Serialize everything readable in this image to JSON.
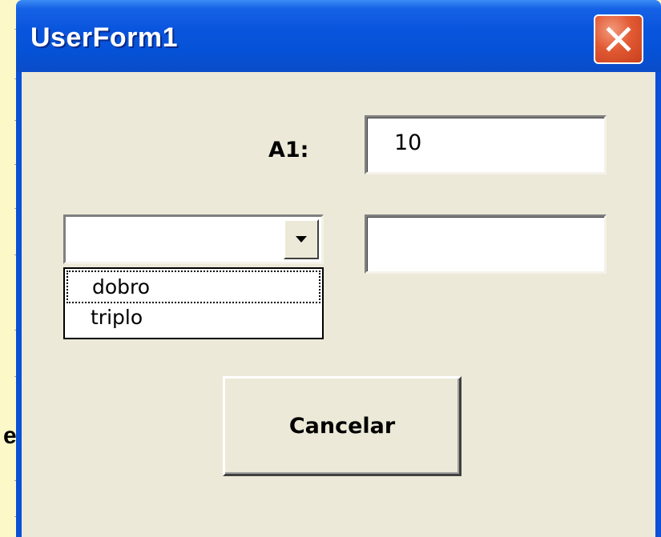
{
  "window": {
    "title": "UserForm1"
  },
  "background": {
    "partial_letter": "e"
  },
  "form": {
    "a1_label": "A1:",
    "a1_value": "10",
    "result_value": "",
    "combo": {
      "selected": "",
      "options": [
        "dobro",
        "triplo"
      ],
      "open": true
    },
    "cancel_label": "Cancelar"
  },
  "colors": {
    "titlebar": "#0a55dd",
    "client": "#ece9d8",
    "close": "#e25a34"
  },
  "icons": {
    "close": "close-icon",
    "dropdown": "chevron-down-icon"
  }
}
